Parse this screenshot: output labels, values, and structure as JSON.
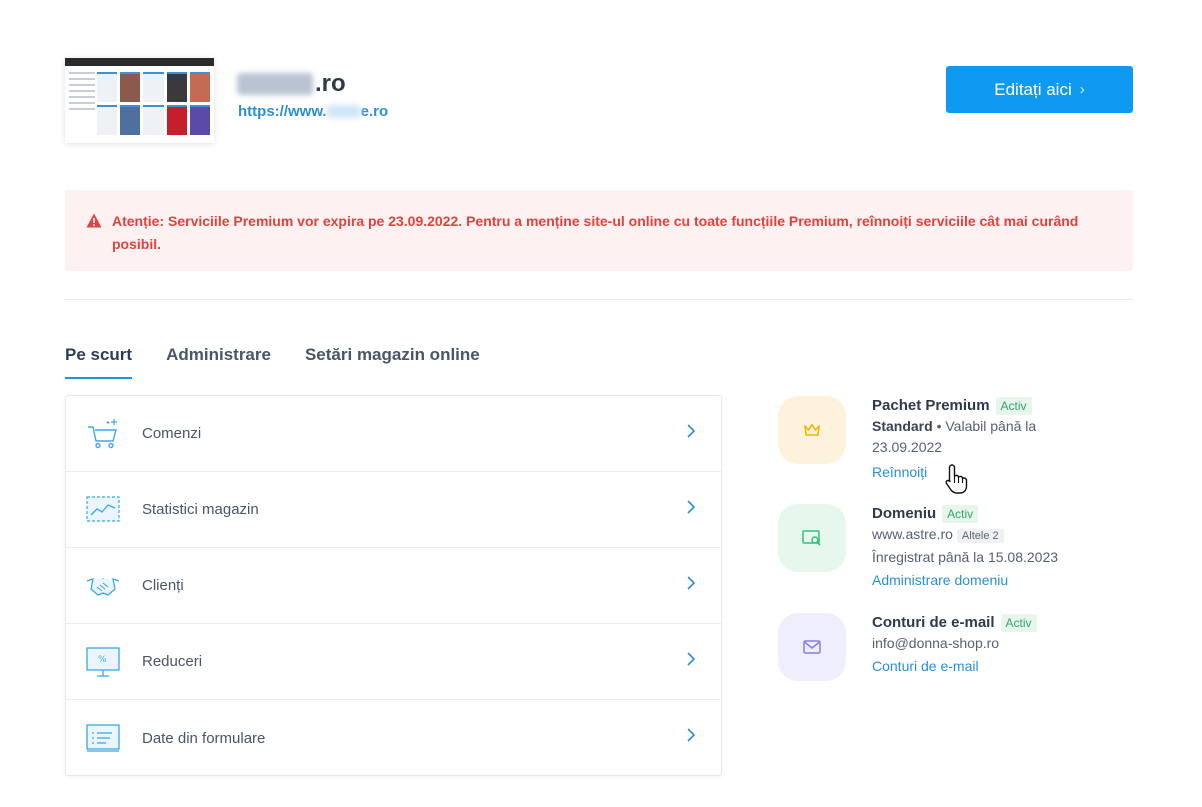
{
  "site": {
    "name_suffix": ".ro",
    "url_prefix": "https://www.",
    "url_suffix": "e.ro"
  },
  "header": {
    "edit_label": "Editați aici",
    "edit_chevron": "›"
  },
  "alert": {
    "text": "Atenție: Serviciile Premium vor expira pe 23.09.2022. Pentru a menține site-ul online cu toate funcțiile Premium, reînnoiți serviciile cât mai curând posibil."
  },
  "tabs": [
    "Pe scurt",
    "Administrare",
    "Setări magazin online"
  ],
  "menu": [
    {
      "label": "Comenzi",
      "icon": "shopping-cart-icon"
    },
    {
      "label": "Statistici magazin",
      "icon": "statistics-chart-icon"
    },
    {
      "label": "Clienți",
      "icon": "handshake-icon"
    },
    {
      "label": "Reduceri",
      "icon": "discount-monitor-icon"
    },
    {
      "label": "Date din formulare",
      "icon": "form-data-icon"
    }
  ],
  "services": {
    "premium": {
      "title": "Pachet Premium",
      "status": "Activ",
      "plan": "Standard",
      "valid_text": " • Valabil până la 23.09.2022",
      "link": "Reînnoiți",
      "icon": "crown-icon",
      "badge_color": "#fdf3dc",
      "icon_color": "#f0b400"
    },
    "domain": {
      "title": "Domeniu",
      "status": "Activ",
      "domain": "www.astre.ro",
      "others": "Altele 2",
      "registered": "Înregistrat până la 15.08.2023",
      "link": "Administrare domeniu",
      "icon": "domain-search-icon",
      "badge_color": "#e6f7ee",
      "icon_color": "#35c07a"
    },
    "email": {
      "title": "Conturi de e-mail",
      "status": "Activ",
      "address": "info@donna-shop.ro",
      "link": "Conturi de e-mail",
      "icon": "envelope-icon",
      "badge_color": "#efeefc",
      "icon_color": "#8a7de0"
    }
  },
  "colors": {
    "primary": "#0f9af2",
    "link": "#2a8fd9",
    "alert_text": "#e0433e",
    "alert_bg": "#fdf1f1",
    "active_green": "#37a36b"
  }
}
